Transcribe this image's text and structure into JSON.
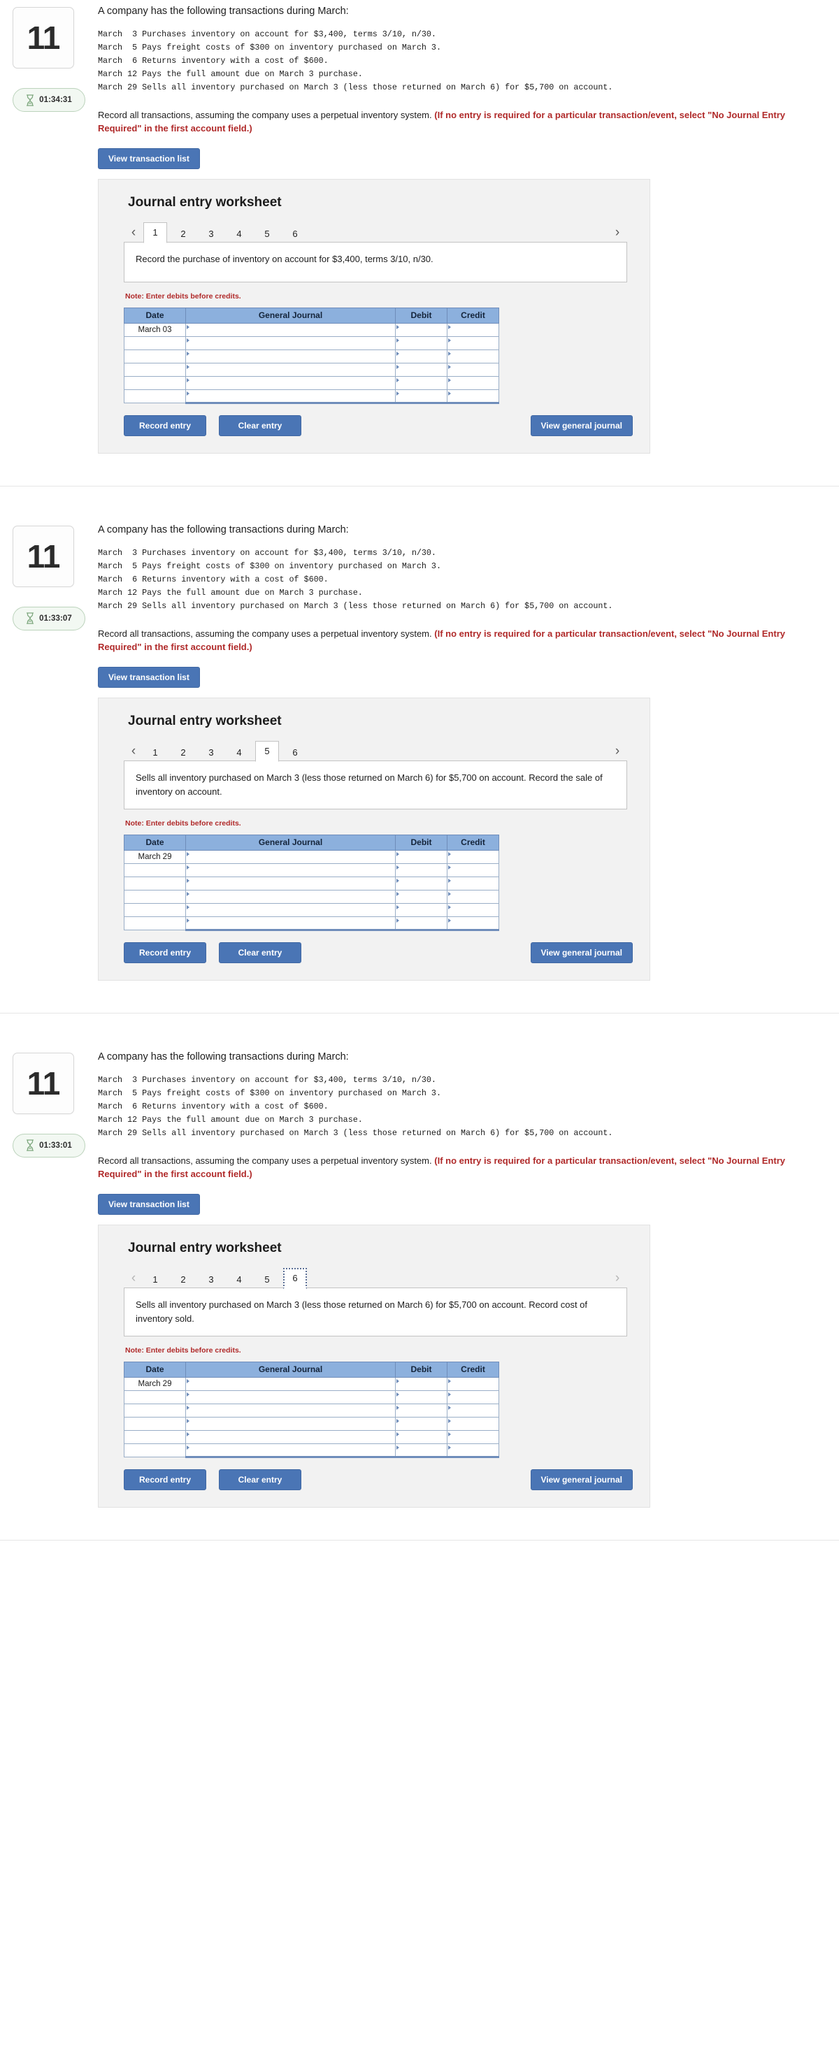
{
  "page": {
    "intro": "A company has the following transactions during March:",
    "transactions_text": "March  3 Purchases inventory on account for $3,400, terms 3/10, n/30.\nMarch  5 Pays freight costs of $300 on inventory purchased on March 3.\nMarch  6 Returns inventory with a cost of $600.\nMarch 12 Pays the full amount due on March 3 purchase.\nMarch 29 Sells all inventory purchased on March 3 (less those returned on March 6) for $5,700 on account.",
    "instruction_normal": "Record all transactions, assuming the company uses a perpetual inventory system. ",
    "instruction_red": "(If no entry is required for a particular transaction/event, select \"No Journal Entry Required\" in the first account field.)",
    "view_transaction_list_label": "View transaction list",
    "worksheet_title": "Journal entry worksheet",
    "note_label": "Note: Enter debits before credits.",
    "record_entry_label": "Record entry",
    "clear_entry_label": "Clear entry",
    "view_general_journal_label": "View general journal",
    "prev_arrow": "‹",
    "next_arrow": "›",
    "columns": [
      "Date",
      "General Journal",
      "Debit",
      "Credit"
    ],
    "accent_blue": "#4a75b5",
    "table_header_blue": "#8cb0dd",
    "red": "#b02a2a"
  },
  "sections": [
    {
      "question_number": "11",
      "timer": "01:34:31",
      "tabs": [
        "1",
        "2",
        "3",
        "4",
        "5",
        "6"
      ],
      "active_tab": "1",
      "tab_focus_style": "active",
      "panel_text": "Record the purchase of inventory on account for $3,400, terms 3/10, n/30.",
      "entry_date": "March 03",
      "row_count": 6
    },
    {
      "question_number": "11",
      "timer": "01:33:07",
      "tabs": [
        "1",
        "2",
        "3",
        "4",
        "5",
        "6"
      ],
      "active_tab": "5",
      "tab_focus_style": "active",
      "panel_text": "Sells all inventory purchased on March 3 (less those returned on March 6) for $5,700 on account. Record the sale of inventory on account.",
      "entry_date": "March 29",
      "row_count": 6
    },
    {
      "question_number": "11",
      "timer": "01:33:01",
      "tabs": [
        "1",
        "2",
        "3",
        "4",
        "5",
        "6"
      ],
      "active_tab": "6",
      "tab_focus_style": "focus-outline",
      "panel_text": "Sells all inventory purchased on March 3 (less those returned on March 6) for $5,700 on account. Record cost of inventory sold.",
      "entry_date": "March 29",
      "row_count": 6
    }
  ]
}
